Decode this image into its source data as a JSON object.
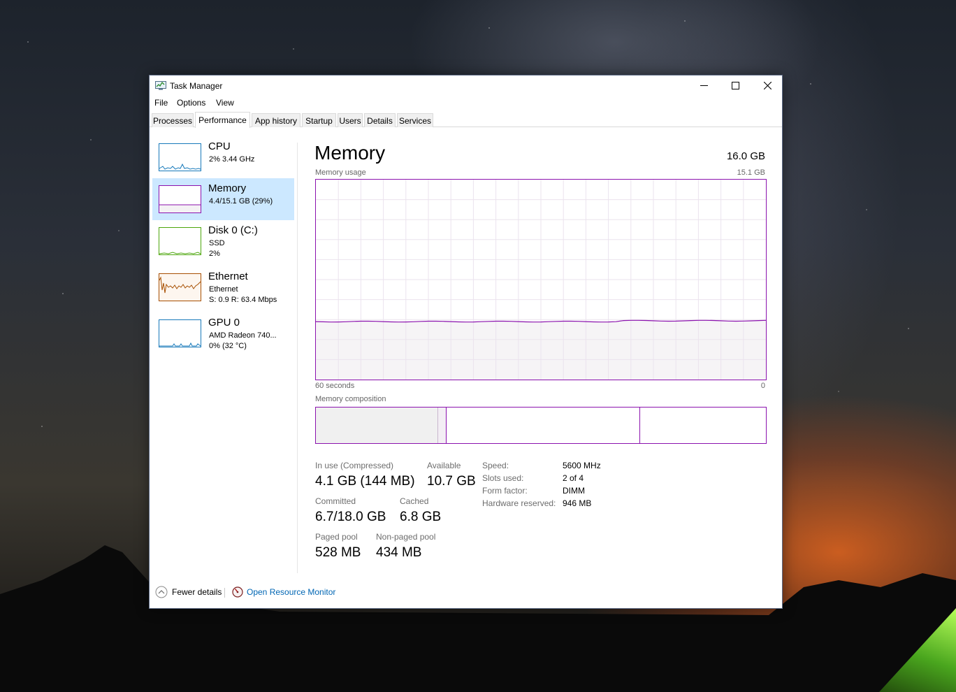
{
  "window": {
    "title": "Task Manager",
    "minimize_icon": "minimize-icon",
    "maximize_icon": "maximize-icon",
    "close_icon": "close-icon"
  },
  "menu": [
    "File",
    "Options",
    "View"
  ],
  "tabs": [
    "Processes",
    "Performance",
    "App history",
    "Startup",
    "Users",
    "Details",
    "Services"
  ],
  "active_tab": "Performance",
  "sidebar": [
    {
      "name": "CPU",
      "line1": "2%  3.44 GHz",
      "line2": "",
      "color": "#1779ba"
    },
    {
      "name": "Memory",
      "line1": "4.4/15.1 GB (29%)",
      "line2": "",
      "color": "#8b12ae"
    },
    {
      "name": "Disk 0 (C:)",
      "line1": "SSD",
      "line2": "2%",
      "color": "#4da60c"
    },
    {
      "name": "Ethernet",
      "line1": "Ethernet",
      "line2": "S: 0.9  R: 63.4 Mbps",
      "color": "#a74f01"
    },
    {
      "name": "GPU 0",
      "line1": "AMD Radeon 740...",
      "line2": "0%  (32 °C)",
      "color": "#1779ba"
    }
  ],
  "selected_sidebar_item": "Memory",
  "main": {
    "title": "Memory",
    "total": "16.0 GB",
    "usage_label": "Memory usage",
    "usage_max": "15.1 GB",
    "axis_left": "60 seconds",
    "axis_right": "0",
    "composition_label": "Memory composition",
    "usage_fraction": 0.29,
    "composition": {
      "in_use_fraction": 0.27,
      "modified_fraction": 0.02,
      "standby_fraction": 0.43,
      "free_fraction": 0.28
    }
  },
  "stats": {
    "in_use_label": "In use (Compressed)",
    "in_use_value": "4.1 GB (144 MB)",
    "available_label": "Available",
    "available_value": "10.7 GB",
    "committed_label": "Committed",
    "committed_value": "6.7/18.0 GB",
    "cached_label": "Cached",
    "cached_value": "6.8 GB",
    "paged_pool_label": "Paged pool",
    "paged_pool_value": "528 MB",
    "nonpaged_pool_label": "Non-paged pool",
    "nonpaged_pool_value": "434 MB"
  },
  "specs": [
    {
      "label": "Speed:",
      "value": "5600 MHz"
    },
    {
      "label": "Slots used:",
      "value": "2 of 4"
    },
    {
      "label": "Form factor:",
      "value": "DIMM"
    },
    {
      "label": "Hardware reserved:",
      "value": "946 MB"
    }
  ],
  "footer": {
    "fewer_details": "Fewer details",
    "open_resource_monitor": "Open Resource Monitor"
  },
  "colors": {
    "memory_accent": "#8b12ae",
    "memory_fill": "#f4f2f4",
    "selected_bg": "#cce8ff",
    "link": "#0066b4"
  }
}
